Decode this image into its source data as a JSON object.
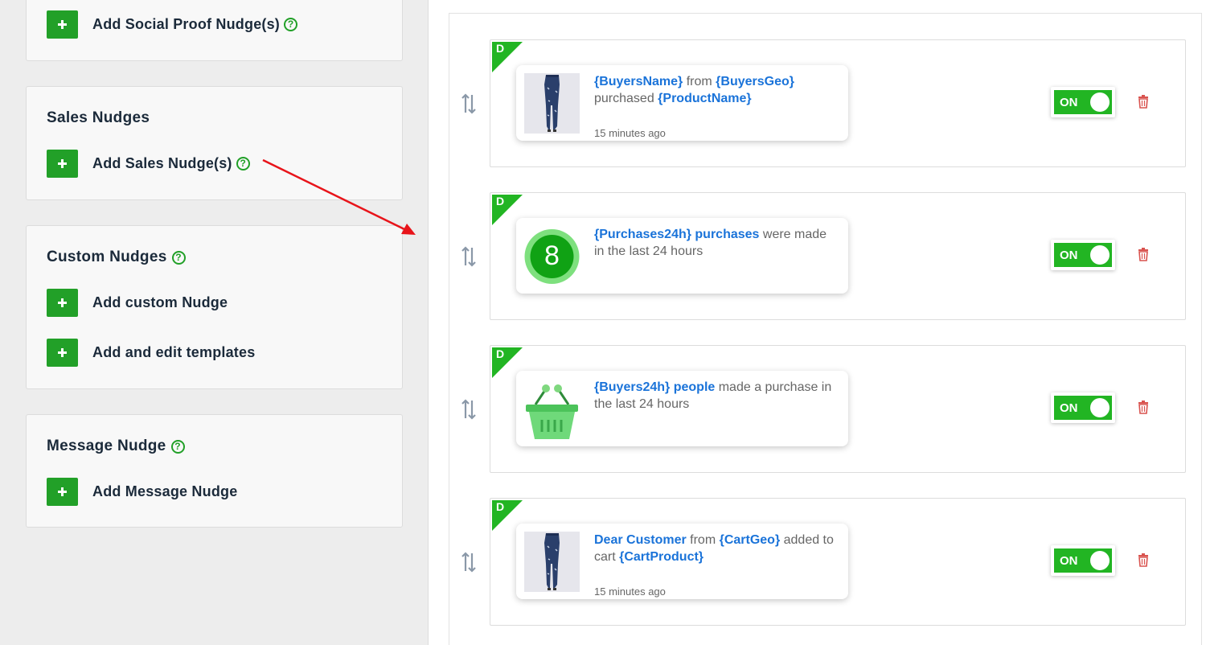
{
  "left_panel": {
    "social_proof": {
      "add_label": "Add Social Proof Nudge(s)"
    },
    "sales": {
      "title": "Sales Nudges",
      "add_label": "Add Sales Nudge(s)"
    },
    "custom": {
      "title": "Custom Nudges",
      "add_custom_label": "Add custom Nudge",
      "add_templates_label": "Add and edit templates"
    },
    "message": {
      "title": "Message Nudge",
      "add_label": "Add Message Nudge"
    },
    "help_glyph": "?"
  },
  "nudges": [
    {
      "tag": "D",
      "image": "jeans-product-photo",
      "message": [
        {
          "text": "{BuyersName}",
          "hl": true
        },
        {
          "text": " from ",
          "hl": false
        },
        {
          "text": "{BuyersGeo}",
          "hl": true
        },
        {
          "text": " purchased ",
          "hl": false
        },
        {
          "text": "{ProductName}",
          "hl": true
        }
      ],
      "time": "15 minutes ago",
      "toggle": "ON"
    },
    {
      "tag": "D",
      "image": "count-badge",
      "badge_number": "8",
      "message": [
        {
          "text": "{Purchases24h} purchases",
          "hl": true
        },
        {
          "text": " were made in the last 24 hours",
          "hl": false
        }
      ],
      "time": "",
      "toggle": "ON"
    },
    {
      "tag": "D",
      "image": "shopping-basket-icon",
      "message": [
        {
          "text": "{Buyers24h} people",
          "hl": true
        },
        {
          "text": " made a purchase in the last 24 hours",
          "hl": false
        }
      ],
      "time": "",
      "toggle": "ON"
    },
    {
      "tag": "D",
      "image": "jeans-product-photo",
      "message": [
        {
          "text": "Dear Customer",
          "hl": true
        },
        {
          "text": " from ",
          "hl": false
        },
        {
          "text": "{CartGeo}",
          "hl": true
        },
        {
          "text": " added to cart ",
          "hl": false
        },
        {
          "text": "{CartProduct}",
          "hl": true
        }
      ],
      "time": "15 minutes ago",
      "toggle": "ON"
    }
  ],
  "colors": {
    "accent_green": "#22a028",
    "toggle_green": "#22b523",
    "link_blue": "#1a73d9",
    "trash_red": "#d9534f",
    "annotation_arrow": "#e8141a"
  }
}
